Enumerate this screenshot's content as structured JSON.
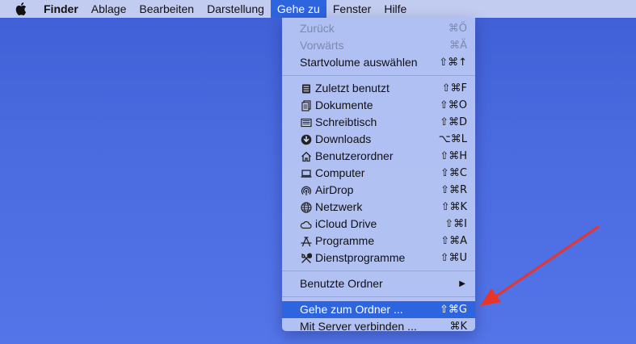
{
  "menubar": {
    "apple_icon": "apple-logo-icon",
    "items": [
      {
        "label": "Finder"
      },
      {
        "label": "Ablage"
      },
      {
        "label": "Bearbeiten"
      },
      {
        "label": "Darstellung"
      },
      {
        "label": "Gehe zu"
      },
      {
        "label": "Fenster"
      },
      {
        "label": "Hilfe"
      }
    ]
  },
  "menu": {
    "group1": [
      {
        "label": "Zurück",
        "shortcut": "⌘Ö",
        "disabled": true
      },
      {
        "label": "Vorwärts",
        "shortcut": "⌘Ä",
        "disabled": true
      },
      {
        "label": "Startvolume auswählen",
        "shortcut": "⇧⌘↑"
      }
    ],
    "group2": [
      {
        "label": "Zuletzt benutzt",
        "shortcut": "⇧⌘F",
        "icon": "recents-icon"
      },
      {
        "label": "Dokumente",
        "shortcut": "⇧⌘O",
        "icon": "documents-icon"
      },
      {
        "label": "Schreibtisch",
        "shortcut": "⇧⌘D",
        "icon": "desktop-icon"
      },
      {
        "label": "Downloads",
        "shortcut": "⌥⌘L",
        "icon": "downloads-icon"
      },
      {
        "label": "Benutzerordner",
        "shortcut": "⇧⌘H",
        "icon": "home-icon"
      },
      {
        "label": "Computer",
        "shortcut": "⇧⌘C",
        "icon": "computer-icon"
      },
      {
        "label": "AirDrop",
        "shortcut": "⇧⌘R",
        "icon": "airdrop-icon"
      },
      {
        "label": "Netzwerk",
        "shortcut": "⇧⌘K",
        "icon": "network-icon"
      },
      {
        "label": "iCloud Drive",
        "shortcut": "⇧⌘I",
        "icon": "icloud-icon"
      },
      {
        "label": "Programme",
        "shortcut": "⇧⌘A",
        "icon": "applications-icon"
      },
      {
        "label": "Dienstprogramme",
        "shortcut": "⇧⌘U",
        "icon": "utilities-icon"
      }
    ],
    "group3": [
      {
        "label": "Benutzte Ordner",
        "submenu_arrow": "▶"
      }
    ],
    "group4": [
      {
        "label": "Gehe zum Ordner ...",
        "shortcut": "⇧⌘G",
        "highlighted": true
      },
      {
        "label": "Mit Server verbinden ...",
        "shortcut": "⌘K"
      }
    ]
  },
  "colors": {
    "highlight": "#2d64e0",
    "annotation_arrow": "#e8352b"
  }
}
